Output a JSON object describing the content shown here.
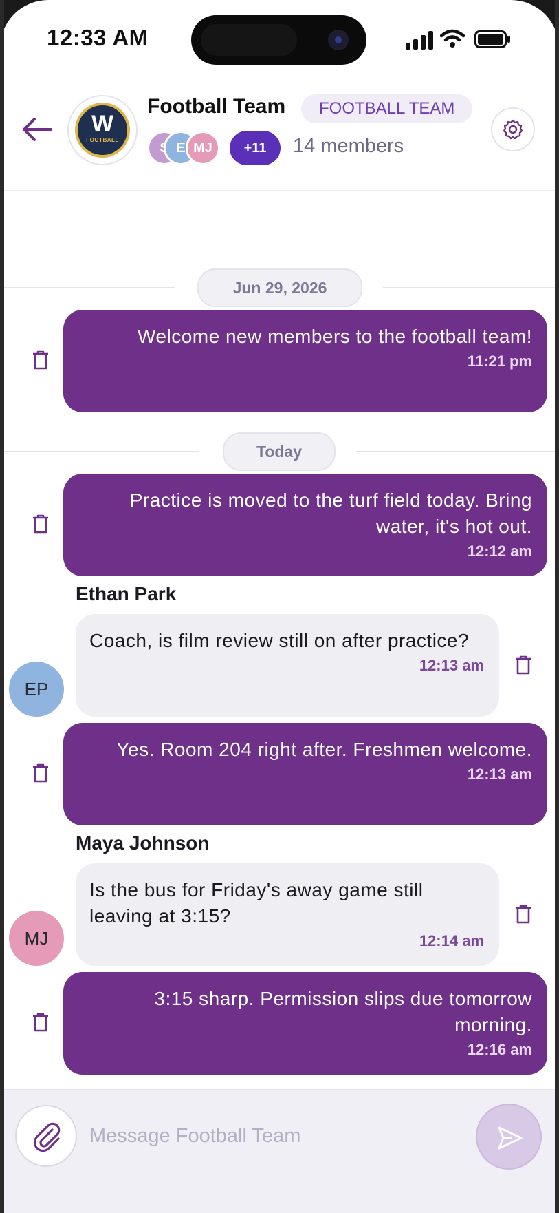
{
  "status_bar": {
    "time": "12:33 AM"
  },
  "header": {
    "group_name": "Football Team",
    "group_tag": "FOOTBALL TEAM",
    "logo_letter": "W",
    "logo_word": "FOOTBALL",
    "members_preview": [
      {
        "initials": "S",
        "color": "#c39bd3"
      },
      {
        "initials": "E",
        "color": "#8fb4df"
      },
      {
        "initials": "MJ",
        "color": "#e59bb7"
      }
    ],
    "more_members": "+11",
    "member_count": "14 members"
  },
  "dividers": {
    "first": "Jun 29, 2026",
    "second": "Today"
  },
  "messages": [
    {
      "direction": "out",
      "text": "Welcome new members to the football team!",
      "time": "11:21 pm"
    },
    {
      "direction": "out",
      "text": "Practice is moved to the turf field today. Bring water, it's hot out.",
      "time": "12:12 am"
    },
    {
      "direction": "in",
      "sender": "Ethan Park",
      "initials": "EP",
      "avatar_color": "#8fb4df",
      "text": "Coach, is film review still on after practice?",
      "time": "12:13 am"
    },
    {
      "direction": "out",
      "text": "Yes. Room 204 right after. Freshmen welcome.",
      "time": "12:13 am"
    },
    {
      "direction": "in",
      "sender": "Maya Johnson",
      "initials": "MJ",
      "avatar_color": "#e59bb7",
      "text": "Is the bus for Friday's away game still leaving at 3:15?",
      "time": "12:14 am"
    },
    {
      "direction": "out",
      "text": "3:15 sharp. Permission slips due tomorrow morning.",
      "time": "12:16 am"
    }
  ],
  "composer": {
    "placeholder": "Message Football Team"
  },
  "colors": {
    "accent": "#6e3088",
    "pill": "#5b30b8"
  },
  "icons": [
    "back-arrow-icon",
    "gear-icon",
    "trash-icon",
    "paperclip-icon",
    "send-icon"
  ]
}
